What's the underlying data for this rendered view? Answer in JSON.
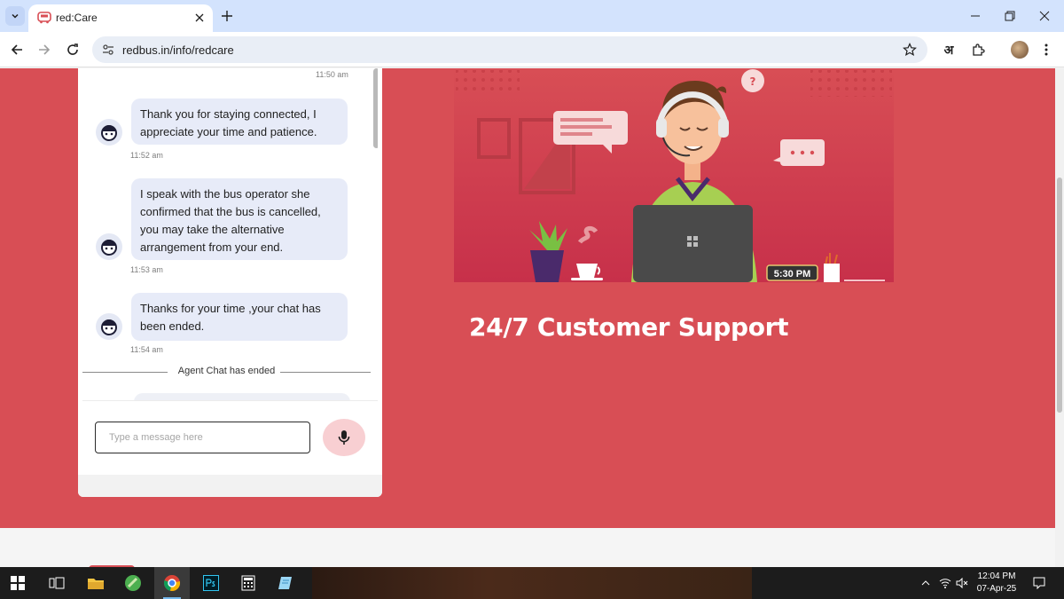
{
  "browser": {
    "tab_title": "red:Care",
    "url": "redbus.in/info/redcare",
    "lang_glyph": "अ"
  },
  "chat": {
    "messages": [
      {
        "time": "11:50 am"
      },
      {
        "text": "Thank you for staying connected, I appreciate your time and patience.",
        "time": "11:52 am"
      },
      {
        "text": "I speak with the bus operator she confirmed that the bus is cancelled, you may take the alternative arrangement from your end.",
        "time": "11:53 am"
      },
      {
        "text": "Thanks for your time ,your chat has been ended.",
        "time": "11:54 am"
      }
    ],
    "ended_label": "Agent Chat has ended",
    "input_placeholder": "Type a message here"
  },
  "hero": {
    "title": "24/7 Customer Support",
    "clock_label": "5:30 PM",
    "question_mark": "?"
  },
  "taskbar": {
    "time": "12:04 PM",
    "date": "07-Apr-25"
  },
  "colors": {
    "brand_red": "#d84e55",
    "bubble_bg": "#e7ebf8",
    "mic_bg": "#f8cfd2"
  }
}
